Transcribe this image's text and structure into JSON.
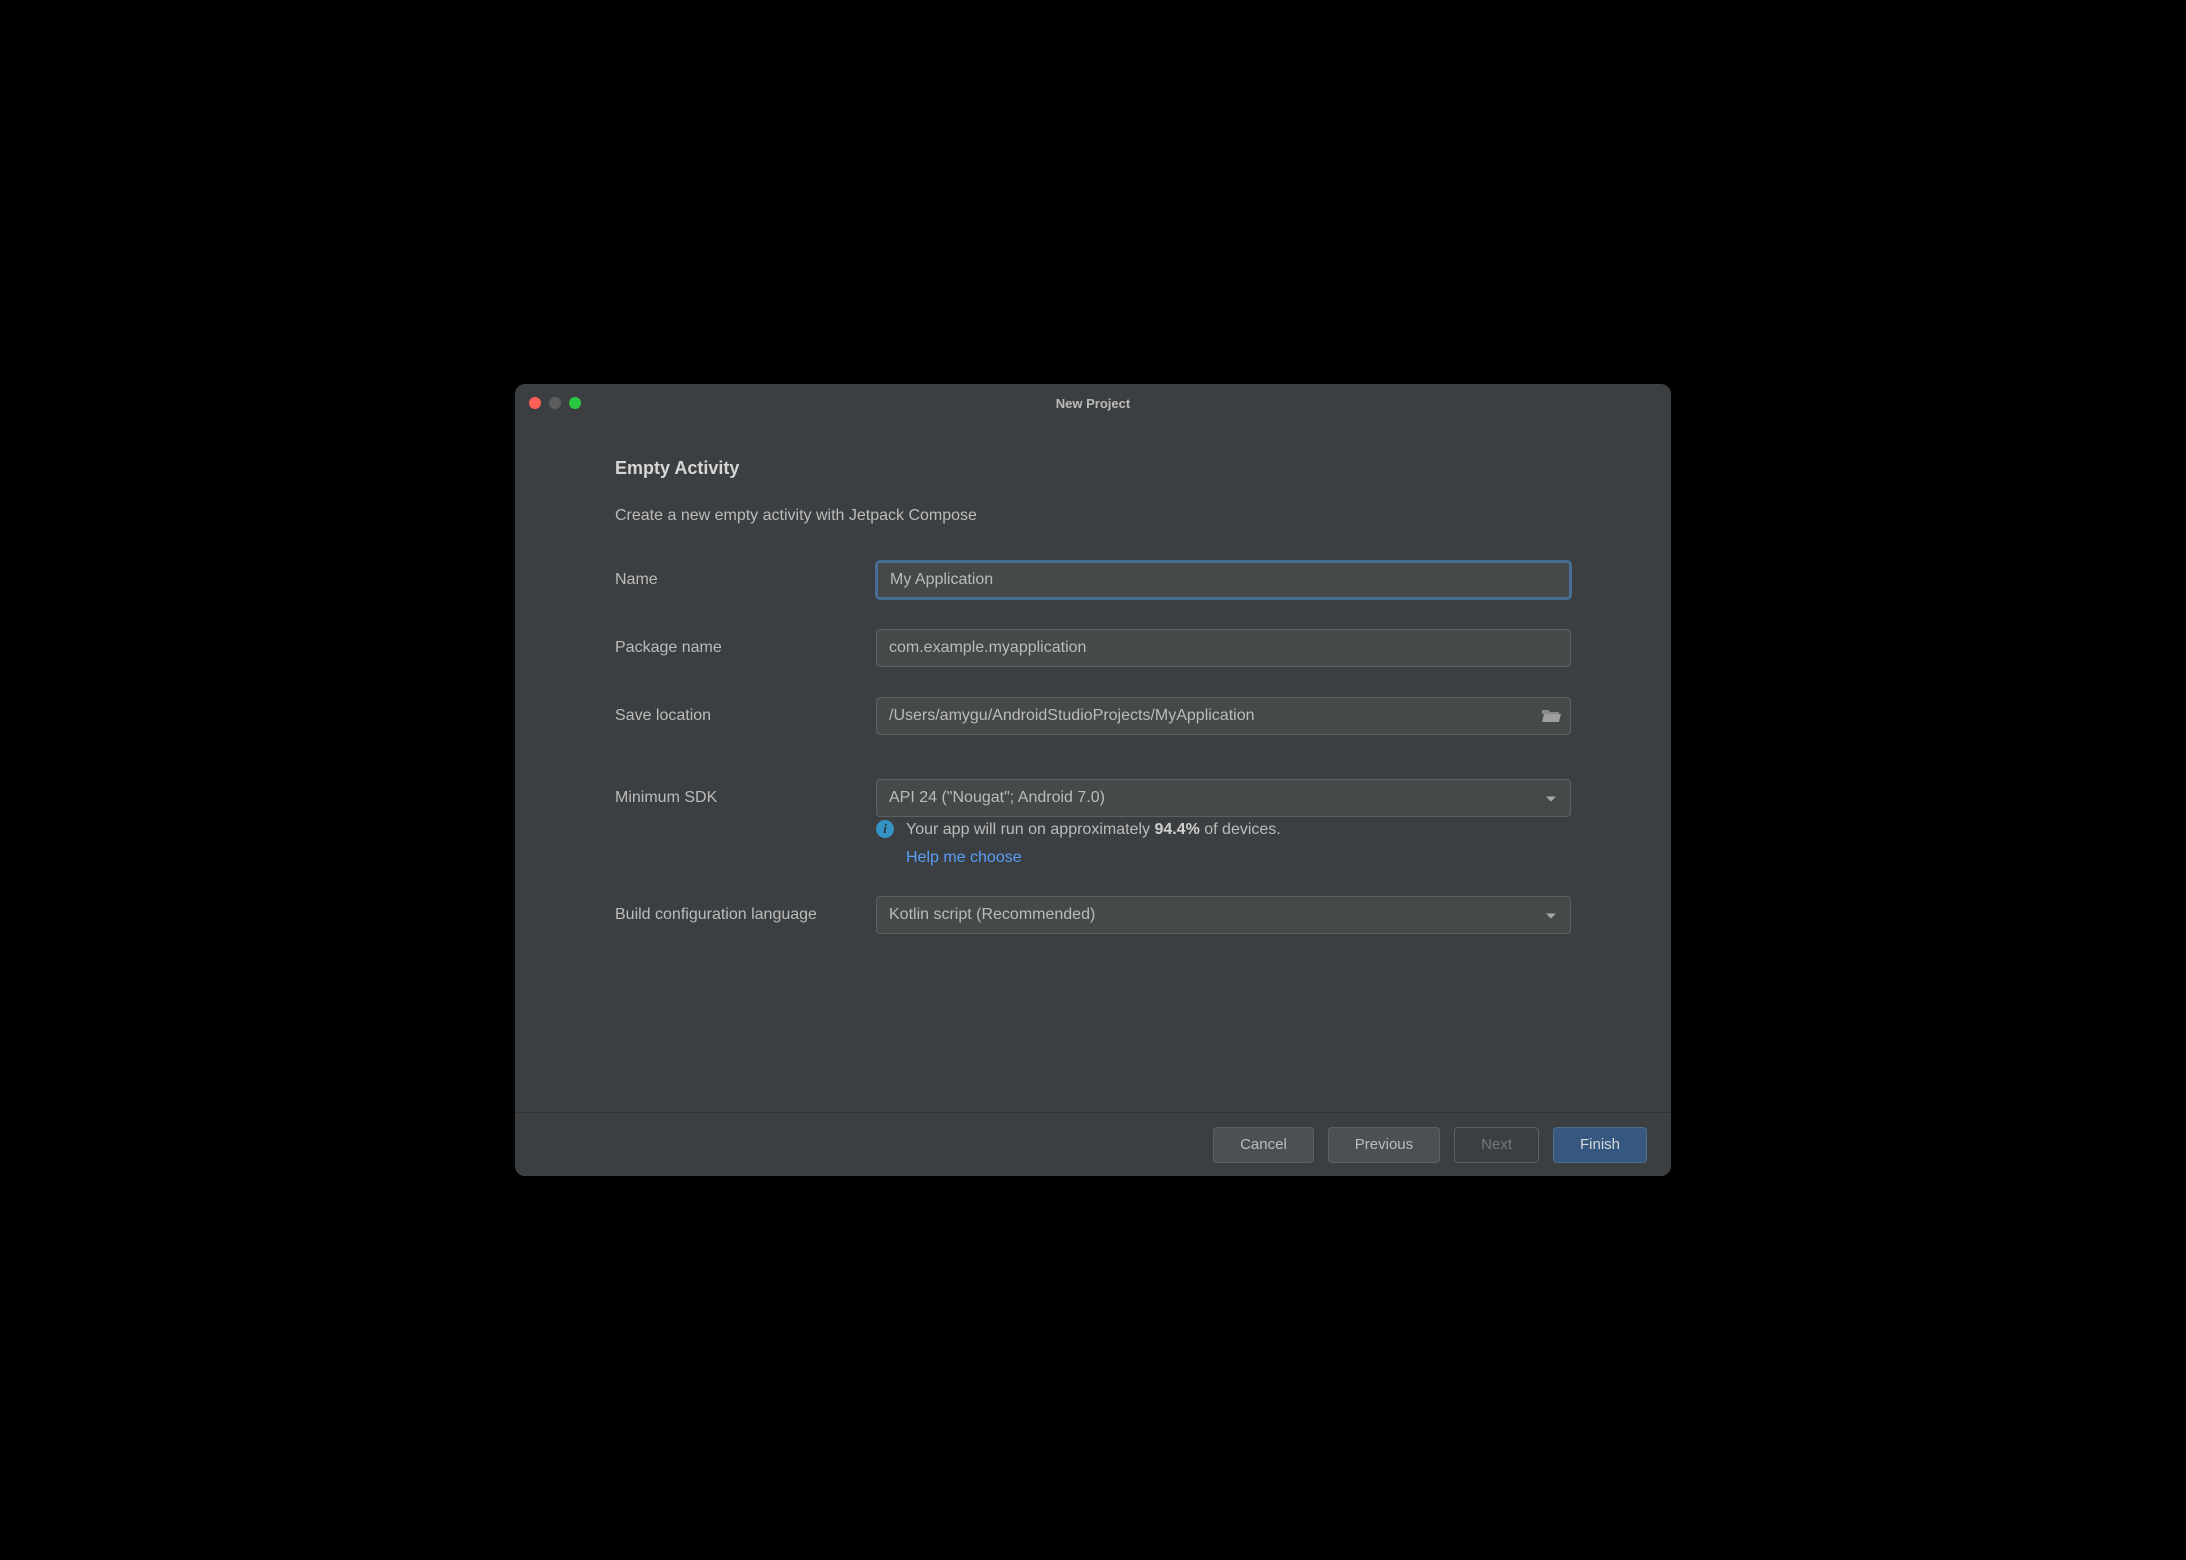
{
  "window": {
    "title": "New Project"
  },
  "page": {
    "heading": "Empty Activity",
    "subheading": "Create a new empty activity with Jetpack Compose"
  },
  "form": {
    "name": {
      "label": "Name",
      "value": "My Application"
    },
    "package": {
      "label": "Package name",
      "value": "com.example.myapplication"
    },
    "location": {
      "label": "Save location",
      "value": "/Users/amygu/AndroidStudioProjects/MyApplication"
    },
    "min_sdk": {
      "label": "Minimum SDK",
      "value": "API 24 (\"Nougat\"; Android 7.0)"
    },
    "sdk_info": {
      "prefix": "Your app will run on approximately ",
      "percent": "94.4%",
      "suffix": " of devices.",
      "help_link": "Help me choose"
    },
    "build_lang": {
      "label": "Build configuration language",
      "value": "Kotlin script (Recommended)"
    }
  },
  "footer": {
    "cancel": "Cancel",
    "previous": "Previous",
    "next": "Next",
    "finish": "Finish"
  }
}
